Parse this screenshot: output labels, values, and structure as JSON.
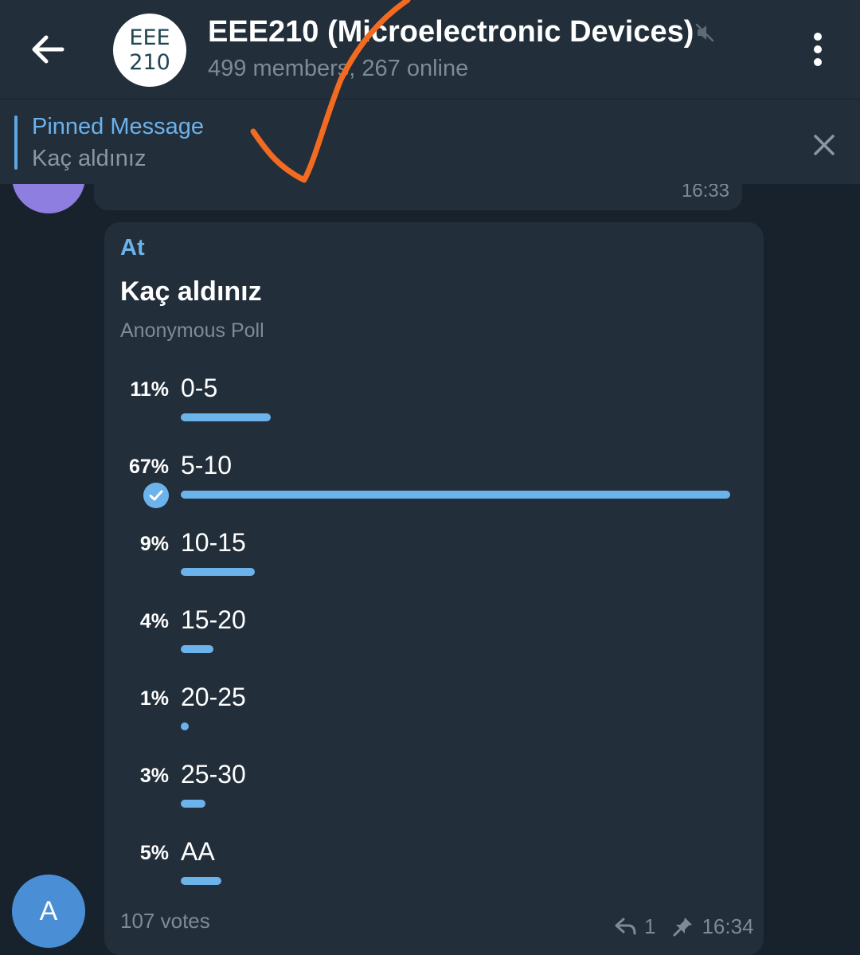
{
  "header": {
    "avatar_line1": "EEE",
    "avatar_line2": "210",
    "title": "EEE210 (Microelectronic Devices)",
    "subtitle": "499 members, 267 online"
  },
  "pinned": {
    "title": "Pinned Message",
    "text": "Kaç aldınız"
  },
  "previous_message": {
    "time": "16:33"
  },
  "poll": {
    "sender": "At",
    "question": "Kaç aldınız",
    "type": "Anonymous Poll",
    "options": [
      {
        "label": "0-5",
        "percent": "11%",
        "fraction": 0.11,
        "chosen": false
      },
      {
        "label": "5-10",
        "percent": "67%",
        "fraction": 0.67,
        "chosen": true
      },
      {
        "label": "10-15",
        "percent": "9%",
        "fraction": 0.09,
        "chosen": false
      },
      {
        "label": "15-20",
        "percent": "4%",
        "fraction": 0.04,
        "chosen": false
      },
      {
        "label": "20-25",
        "percent": "1%",
        "fraction": 0.01,
        "chosen": false
      },
      {
        "label": "25-30",
        "percent": "3%",
        "fraction": 0.03,
        "chosen": false
      },
      {
        "label": "AA",
        "percent": "5%",
        "fraction": 0.05,
        "chosen": false
      }
    ],
    "votes": "107 votes",
    "replies": "1",
    "time": "16:34"
  },
  "bottom_avatar": {
    "initial": "A",
    "color": "#4a8fd6"
  },
  "colors": {
    "accent": "#6cb2eb",
    "background": "#18222d",
    "bubble": "#222e3a",
    "annotation": "#f26b21"
  },
  "icons": {
    "back": "back-arrow-icon",
    "mute": "mute-icon",
    "menu": "more-vertical-icon",
    "close": "close-icon",
    "chosen": "check-circle-icon",
    "reply": "reply-icon",
    "pin": "pin-icon"
  }
}
